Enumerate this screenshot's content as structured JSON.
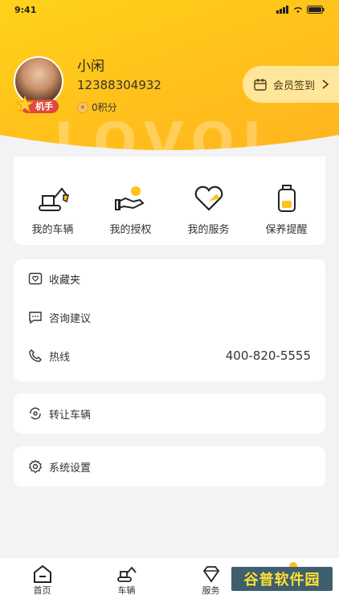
{
  "status_bar": {
    "time": "9:41"
  },
  "header": {
    "watermark_text": "LOVOL"
  },
  "profile": {
    "name": "小闲",
    "phone": "12388304932",
    "points": "0积分",
    "badge": "机手"
  },
  "signin": {
    "label": "会员签到"
  },
  "quick_actions": [
    {
      "label": "我的车辆",
      "icon": "excavator-icon"
    },
    {
      "label": "我的授权",
      "icon": "hand-coin-icon"
    },
    {
      "label": "我的服务",
      "icon": "heart-icon"
    },
    {
      "label": "保养提醒",
      "icon": "oil-bottle-icon"
    }
  ],
  "menu": {
    "favorites": "收藏夹",
    "advice": "咨询建议",
    "hotline": "热线",
    "hotline_number": "400-820-5555",
    "transfer": "转让车辆",
    "settings": "系统设置"
  },
  "bottom_nav": [
    {
      "label": "首页",
      "icon": "home-icon"
    },
    {
      "label": "车辆",
      "icon": "vehicle-icon"
    },
    {
      "label": "服务",
      "icon": "diamond-icon"
    }
  ],
  "overlay_watermark": "谷普软件园",
  "colors": {
    "brand": "#ffc31b",
    "badge": "#e0493b",
    "signin_bg": "#ffe69a"
  }
}
